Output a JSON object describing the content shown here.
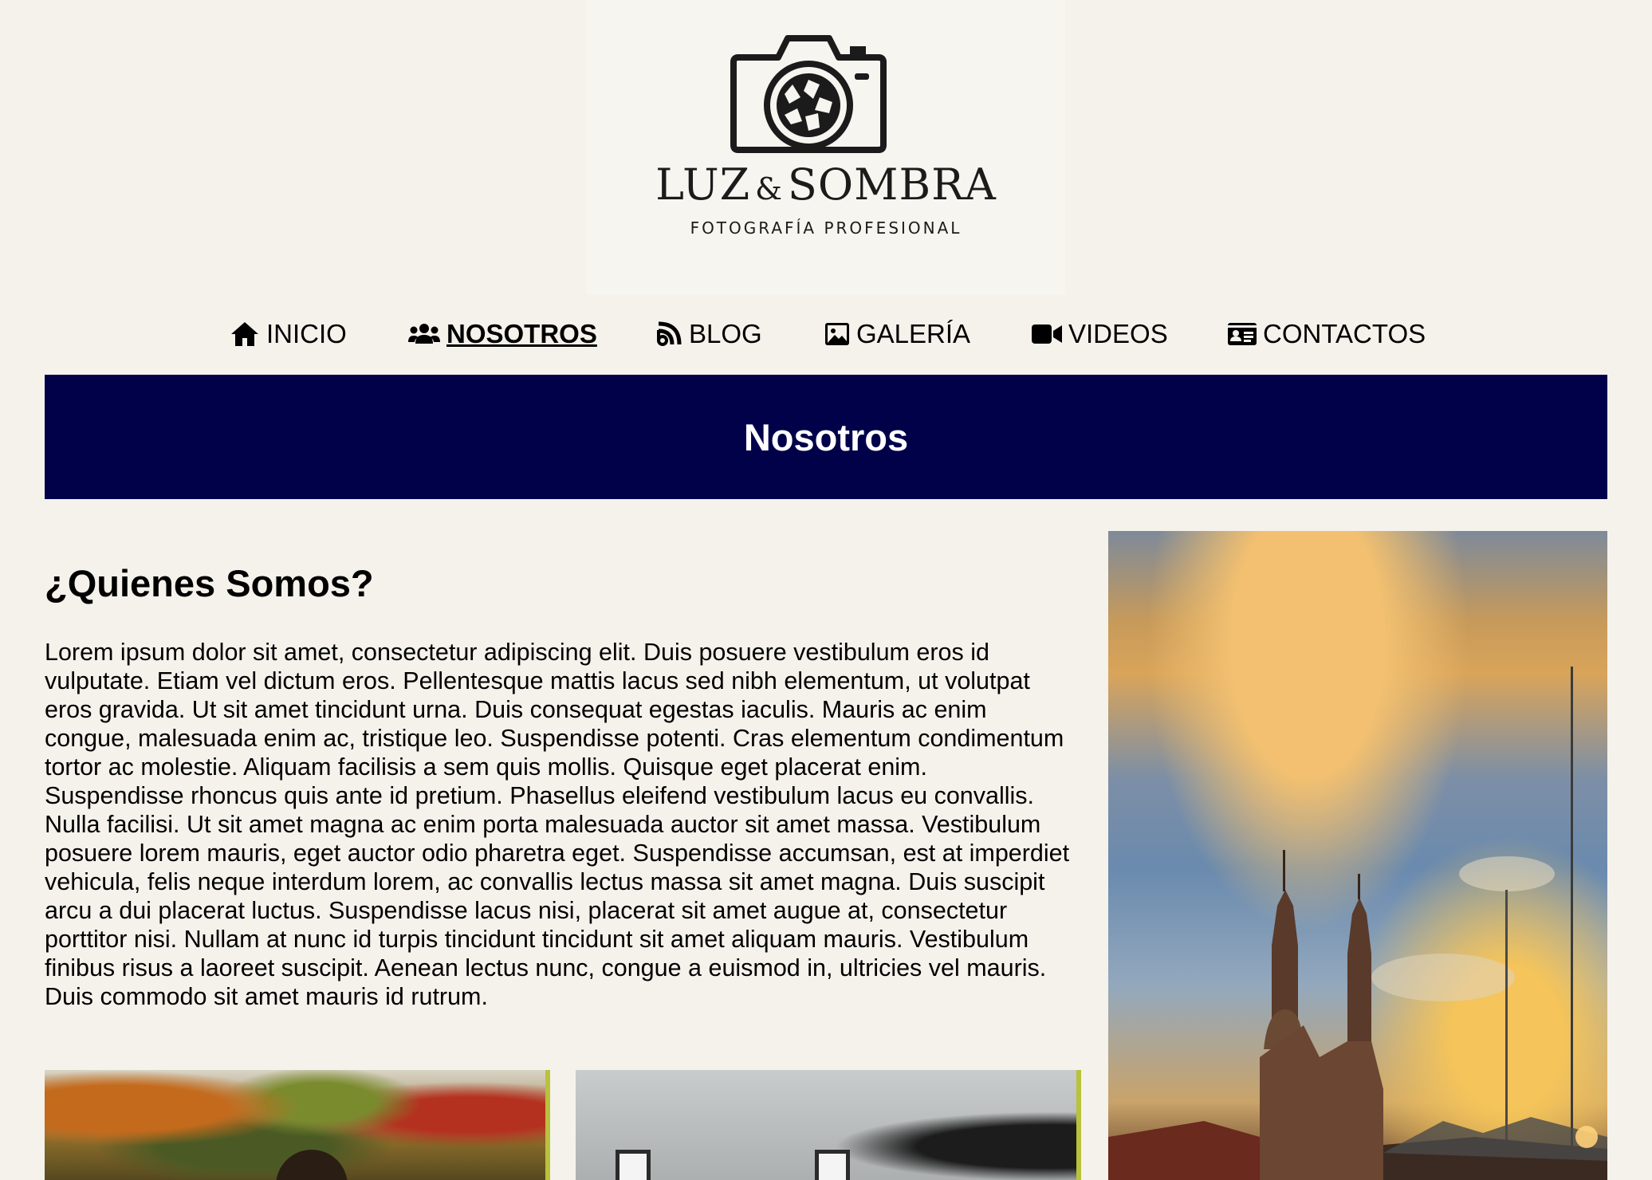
{
  "logo": {
    "title_left": "LUZ",
    "title_amp": "&",
    "title_right": "SOMBRA",
    "subtitle": "FOTOGRAFÍA PROFESIONAL"
  },
  "nav": {
    "items": [
      {
        "label": "INICIO",
        "icon": "home-icon"
      },
      {
        "label": "NOSOTROS",
        "icon": "users-icon",
        "active": true
      },
      {
        "label": "BLOG",
        "icon": "rss-icon"
      },
      {
        "label": "GALERÍA",
        "icon": "image-icon"
      },
      {
        "label": "VIDEOS",
        "icon": "video-icon"
      },
      {
        "label": "CONTACTOS",
        "icon": "contact-card-icon"
      }
    ]
  },
  "banner": {
    "title": "Nosotros"
  },
  "main": {
    "heading": "¿Quienes Somos?",
    "paragraph": "Lorem ipsum dolor sit amet, consectetur adipiscing elit. Duis posuere vestibulum eros id vulputate. Etiam vel dictum eros. Pellentesque mattis lacus sed nibh elementum, ut volutpat eros gravida. Ut sit amet tincidunt urna. Duis consequat egestas iaculis. Mauris ac enim congue, malesuada enim ac, tristique leo. Suspendisse potenti. Cras elementum condimentum tortor ac molestie. Aliquam facilisis a sem quis mollis. Quisque eget placerat enim. Suspendisse rhoncus quis ante id pretium. Phasellus eleifend vestibulum lacus eu convallis. Nulla facilisi. Ut sit amet magna ac enim porta malesuada auctor sit amet massa. Vestibulum posuere lorem mauris, eget auctor odio pharetra eget. Suspendisse accumsan, est at imperdiet vehicula, felis neque interdum lorem, ac convallis lectus massa sit amet magna. Duis suscipit arcu a dui placerat luctus. Suspendisse lacus nisi, placerat sit amet augue at, consectetur porttitor nisi. Nullam at nunc id turpis tincidunt tincidunt sit amet aliquam mauris. Vestibulum finibus risus a laoreet suscipit. Aenean lectus nunc, congue a euismod in, ultricies vel mauris. Duis commodo sit amet mauris id rutrum."
  },
  "colors": {
    "page_background": "#f5f2ec",
    "banner_background": "#01014a",
    "banner_text": "#ffffff",
    "photo_accent": "#b8c23a"
  }
}
